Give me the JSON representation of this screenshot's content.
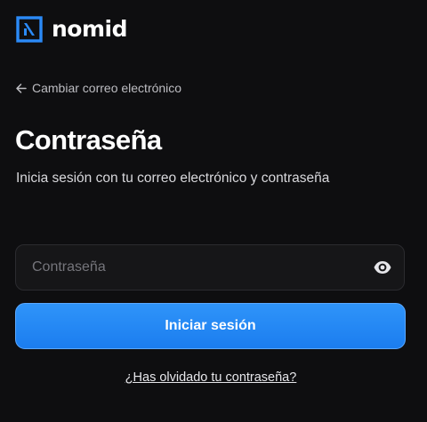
{
  "brand": {
    "name": "nomid",
    "logo_icon": "nomid-logo-icon",
    "accent_color": "#2b8af7"
  },
  "back_link": {
    "icon": "arrow-left-icon",
    "label": "Cambiar correo electrónico"
  },
  "heading": {
    "title": "Contraseña",
    "subtitle": "Inicia sesión con tu correo electrónico y contraseña"
  },
  "password_field": {
    "value": "",
    "placeholder": "Contraseña",
    "toggle_icon": "eye-icon"
  },
  "submit": {
    "label": "Iniciar sesión",
    "color": "#2b8af7"
  },
  "forgot_link": {
    "label": "¿Has olvidado tu contraseña?"
  },
  "colors": {
    "background": "#0e0e10",
    "input_background": "#161618"
  }
}
